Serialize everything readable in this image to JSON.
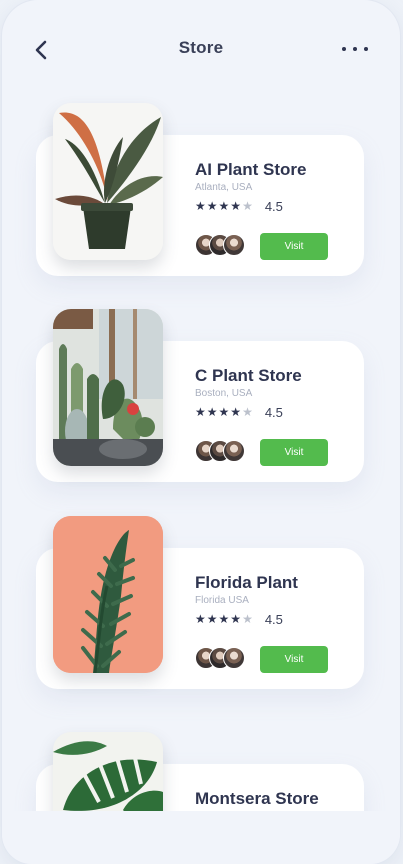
{
  "header": {
    "title": "Store",
    "back_icon": "chevron-left-icon",
    "more_icon": "more-horizontal-icon"
  },
  "stores": [
    {
      "name": "AI Plant Store",
      "location": "Atlanta, USA",
      "stars": 4,
      "rating": "4.5",
      "visit_label": "Visit"
    },
    {
      "name": "C Plant Store",
      "location": "Boston, USA",
      "stars": 4,
      "rating": "4.5",
      "visit_label": "Visit"
    },
    {
      "name": "Florida Plant",
      "location": "Florida USA",
      "stars": 4,
      "rating": "4.5",
      "visit_label": "Visit"
    },
    {
      "name": "Montsera Store"
    }
  ],
  "colors": {
    "accent": "#53bb4d",
    "text": "#2f3550",
    "muted": "#a9afbf",
    "background": "#f1f4fa"
  }
}
